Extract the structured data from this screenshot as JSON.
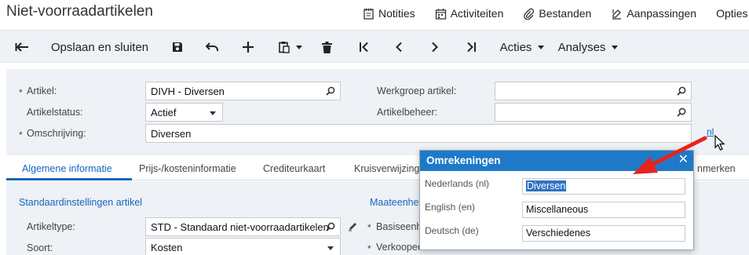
{
  "header": {
    "title": "Niet-voorraadartikelen",
    "links": [
      {
        "label": "Notities",
        "icon": "notes-icon"
      },
      {
        "label": "Activiteiten",
        "icon": "calendar-icon"
      },
      {
        "label": "Bestanden",
        "icon": "paperclip-icon"
      },
      {
        "label": "Aanpassingen",
        "icon": "customize-icon"
      },
      {
        "label": "Opties",
        "icon": ""
      }
    ]
  },
  "toolbar": {
    "back_icon": "back-arrow-icon",
    "save_close_label": "Opslaan en sluiten",
    "save_icon": "save-icon",
    "undo_icon": "undo-icon",
    "add_icon": "add-icon",
    "copy_icon": "copy-paste-icon",
    "delete_icon": "trash-icon",
    "first_icon": "first-record-icon",
    "prev_icon": "previous-icon",
    "next_icon": "next-icon",
    "last_icon": "last-record-icon",
    "actions_label": "Acties",
    "analyses_label": "Analyses"
  },
  "form": {
    "artikel_label": "Artikel:",
    "artikel_value": "DIVH - Diversen",
    "artikelstatus_label": "Artikelstatus:",
    "artikelstatus_value": "Actief",
    "omschrijving_label": "Omschrijving:",
    "omschrijving_value": "Diversen",
    "werkgroep_label": "Werkgroep artikel:",
    "werkgroep_value": "",
    "artikelbeheer_label": "Artikelbeheer:",
    "artikelbeheer_value": "",
    "lang_link": "nl",
    "required_mark": "*"
  },
  "tabs": [
    {
      "label": "Algemene informatie",
      "active": true
    },
    {
      "label": "Prijs-/kosteninformatie",
      "active": false
    },
    {
      "label": "Crediteurkaart",
      "active": false
    },
    {
      "label": "Kruisverwijzing",
      "active": false
    },
    {
      "label": "nmerken",
      "active": false
    }
  ],
  "general": {
    "section_title": "Standaardinstellingen artikel",
    "artikeltype_label": "Artikeltype:",
    "artikeltype_value": "STD - Standaard niet-voorraadartikelen",
    "soort_label": "Soort:",
    "soort_value": "Kosten",
    "units_section_title": "Maateenhei",
    "basis_label": "Basiseenh",
    "verkoop_label": "Verkoopee"
  },
  "popup": {
    "title": "Omrekeningen",
    "close_icon": "close-icon",
    "rows": [
      {
        "label": "Nederlands (nl)",
        "value": "Diversen",
        "selected": true
      },
      {
        "label": "English (en)",
        "value": "Miscellaneous",
        "selected": false
      },
      {
        "label": "Deutsch (de)",
        "value": "Verschiedenes",
        "selected": false
      }
    ]
  },
  "colors": {
    "accent": "#1e7ac8",
    "link": "#1565c0",
    "annotation_arrow": "#e8231c"
  }
}
